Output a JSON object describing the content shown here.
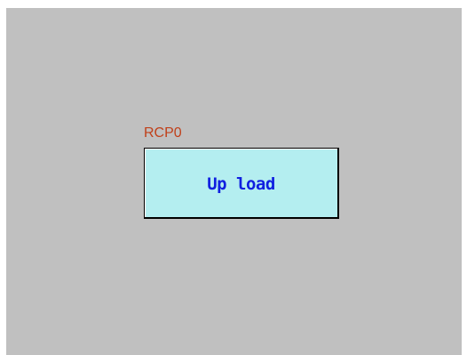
{
  "panel": {
    "label": "RCP0",
    "button_label": "Up load"
  },
  "colors": {
    "background": "#c0c0c0",
    "label_color": "#c0401a",
    "button_fill": "#b4eef0",
    "button_text": "#1020e0"
  }
}
